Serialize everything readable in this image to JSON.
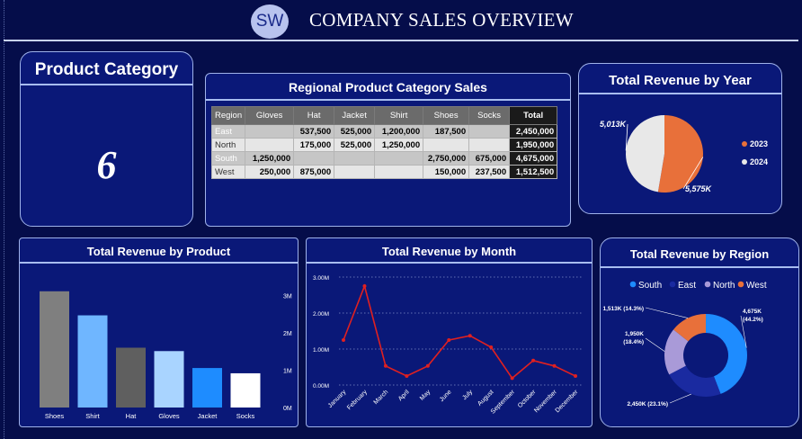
{
  "header": {
    "logo_text": "SW",
    "title": "COMPANY SALES OVERVIEW"
  },
  "kpi": {
    "title": "Product Category",
    "value": "6"
  },
  "regional_table": {
    "title": "Regional Product Category Sales",
    "columns": [
      "Region",
      "Gloves",
      "Hat",
      "Jacket",
      "Shirt",
      "Shoes",
      "Socks",
      "Total"
    ],
    "rows": [
      [
        "East",
        "",
        "537,500",
        "525,000",
        "1,200,000",
        "187,500",
        "",
        "2,450,000"
      ],
      [
        "North",
        "",
        "175,000",
        "525,000",
        "1,250,000",
        "",
        "",
        "1,950,000"
      ],
      [
        "South",
        "1,250,000",
        "",
        "",
        "",
        "2,750,000",
        "675,000",
        "4,675,000"
      ],
      [
        "West",
        "250,000",
        "875,000",
        "",
        "",
        "150,000",
        "237,500",
        "1,512,500"
      ]
    ]
  },
  "chart_data": [
    {
      "type": "pie",
      "title": "Total Revenue by Year",
      "categories": [
        "2023",
        "2024"
      ],
      "values": [
        5575,
        5013
      ],
      "data_labels": [
        "5,575K",
        "5,013K"
      ],
      "colors": [
        "#e8703a",
        "#e8e8e8"
      ],
      "legend_position": "right"
    },
    {
      "type": "bar",
      "title": "Total Revenue by Product",
      "categories": [
        "Shoes",
        "Shirt",
        "Hat",
        "Gloves",
        "Jacket",
        "Socks"
      ],
      "values": [
        3.09,
        2.45,
        1.59,
        1.5,
        1.05,
        0.91
      ],
      "colors": [
        "#7f7f7f",
        "#6fb6ff",
        "#5f5f5f",
        "#a9d4ff",
        "#1e8cff",
        "#ffffff"
      ],
      "y_ticks": [
        "0M",
        "1M",
        "2M",
        "3M"
      ],
      "ylim": [
        0,
        3.3
      ]
    },
    {
      "type": "line",
      "title": "Total Revenue by Month",
      "categories": [
        "January",
        "February",
        "March",
        "April",
        "May",
        "June",
        "July",
        "August",
        "September",
        "October",
        "November",
        "December"
      ],
      "values": [
        1.25,
        2.75,
        0.53,
        0.25,
        0.53,
        1.25,
        1.37,
        1.05,
        0.19,
        0.68,
        0.53,
        0.25
      ],
      "y_ticks": [
        "0.00M",
        "1.00M",
        "2.00M",
        "3.00M"
      ],
      "ylim": [
        0,
        3.0
      ],
      "color": "#e02020",
      "grid": true
    },
    {
      "type": "pie",
      "title": "Total Revenue by Region",
      "categories": [
        "South",
        "East",
        "North",
        "West"
      ],
      "values": [
        4675,
        2450,
        1950,
        1513
      ],
      "percents": [
        "44.2%",
        "23.1%",
        "18.4%",
        "14.3%"
      ],
      "data_labels": [
        "4,675K (44.2%)",
        "2,450K (23.1%)",
        "1,950K (18.4%)",
        "1,513K (14.3%)"
      ],
      "colors": [
        "#1e8cff",
        "#1a2aa0",
        "#a99ad8",
        "#e8703a"
      ],
      "donut": true,
      "legend_position": "top"
    }
  ]
}
